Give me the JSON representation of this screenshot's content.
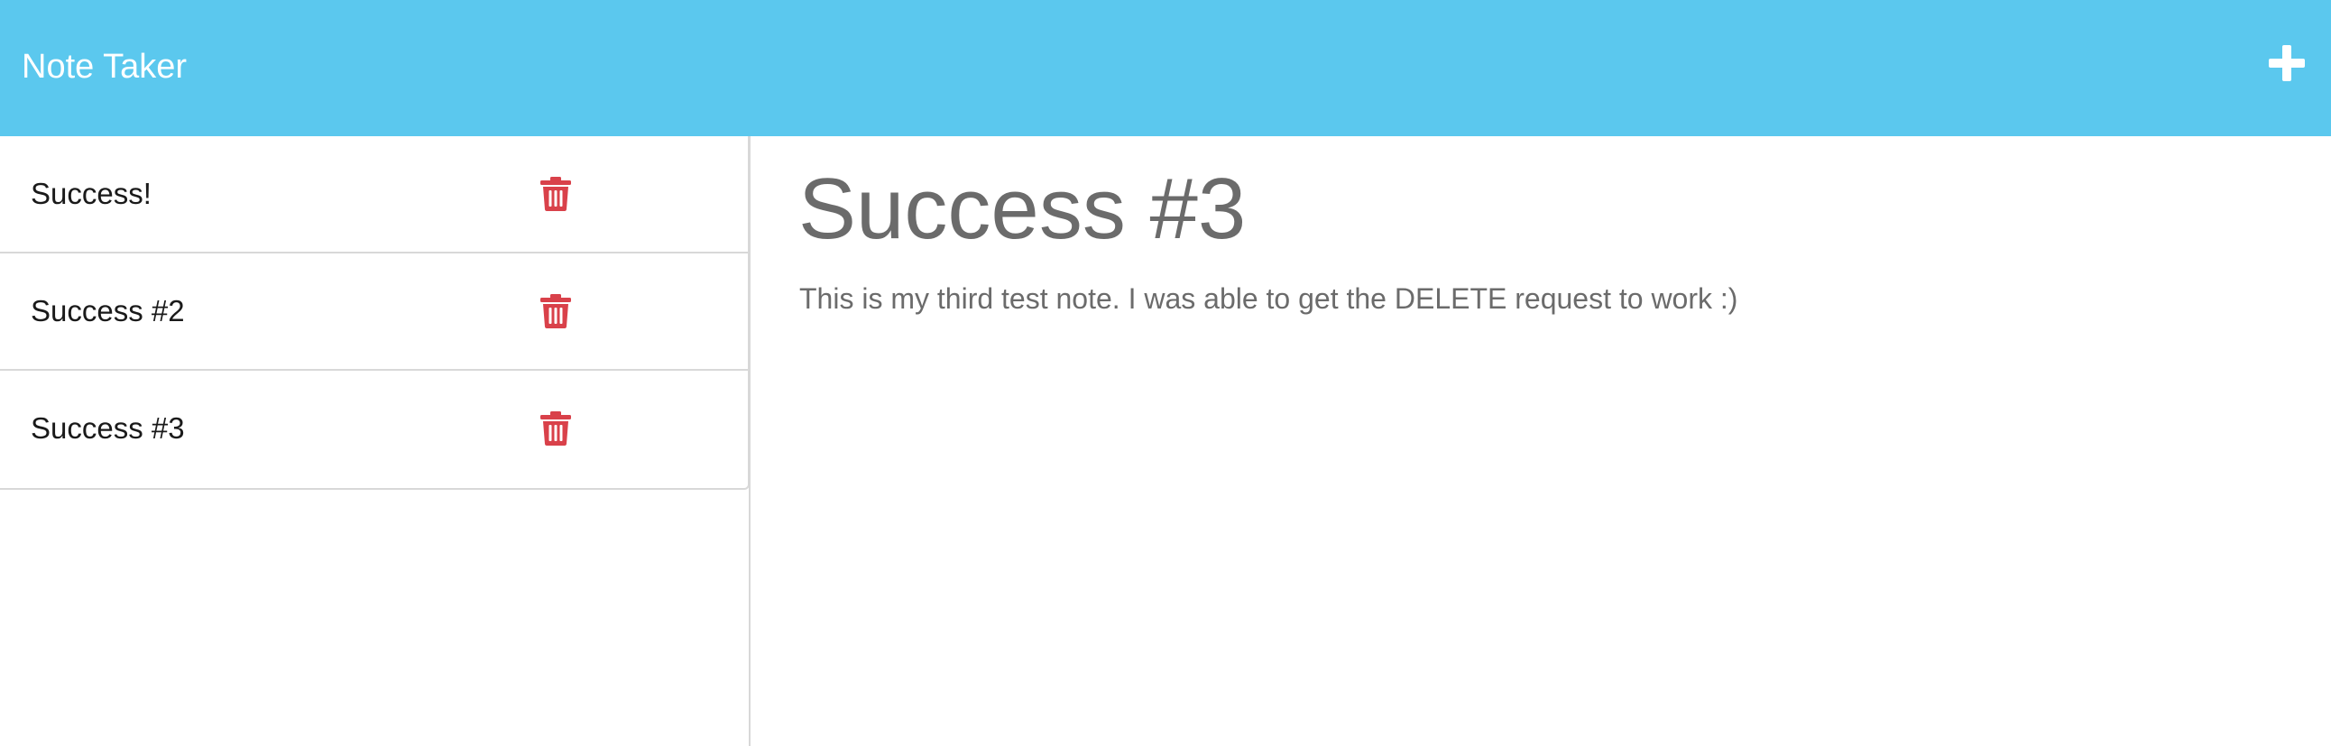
{
  "navbar": {
    "brand": "Note Taker",
    "new_note_icon": "plus-icon",
    "background_color": "#5bc8ee"
  },
  "sidebar": {
    "notes": [
      {
        "title": "Success!",
        "delete_icon": "trash-icon"
      },
      {
        "title": "Success #2",
        "delete_icon": "trash-icon"
      },
      {
        "title": "Success #3",
        "delete_icon": "trash-icon"
      }
    ],
    "delete_color": "#d9414a"
  },
  "editor": {
    "title": "Success #3",
    "text": "This is my third test note. I was able to get the DELETE request to work :)"
  }
}
